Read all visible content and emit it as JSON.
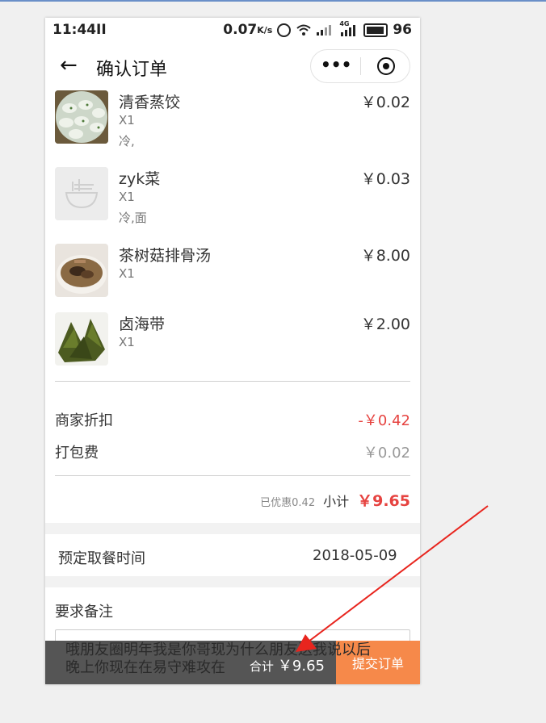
{
  "status_bar": {
    "time": "11:44",
    "pause_icon": "II",
    "net_speed": "0.07",
    "net_unit": "K/s",
    "signal_4g": "4G",
    "battery": "96"
  },
  "nav": {
    "back_icon": "←",
    "title": "确认订单",
    "more_icon": "•••"
  },
  "items": [
    {
      "name": "清香蒸饺",
      "qty": "X1",
      "note": "冷,",
      "price": "￥0.02"
    },
    {
      "name": "zyk菜",
      "qty": "X1",
      "note": "冷,面",
      "price": "￥0.03"
    },
    {
      "name": "茶树菇排骨汤",
      "qty": "X1",
      "note": "",
      "price": "￥8.00"
    },
    {
      "name": "卤海带",
      "qty": "X1",
      "note": "",
      "price": "￥2.00"
    }
  ],
  "fees": {
    "discount_label": "商家折扣",
    "discount_value": "-￥0.42",
    "packing_label": "打包费",
    "packing_value": "￥0.02"
  },
  "subtotal": {
    "saved": "已优惠0.42",
    "label": "小计",
    "value": "￥9.65"
  },
  "reservation": {
    "label": "预定取餐时间",
    "value": "2018-05-09"
  },
  "remark": {
    "label": "要求备注",
    "text_line1": "哦朋友圈明年我是你哥现为什么朋友送我说以后",
    "text_line2": "晚上你现在在易守难攻在"
  },
  "bottom": {
    "total_label": "合计",
    "total_value": "￥9.65",
    "submit_label": "提交订单"
  },
  "colors": {
    "accent_red": "#e64340",
    "submit_orange": "#f6894a",
    "annotation_arrow": "#e8251e"
  }
}
